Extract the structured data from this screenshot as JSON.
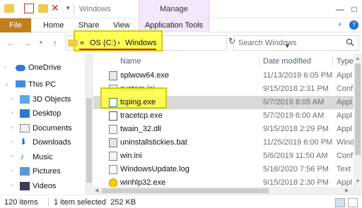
{
  "window": {
    "title": "Windows",
    "manage_label": "Manage",
    "minimize": "—",
    "maximize": "□"
  },
  "ribbon": {
    "tabs": [
      "File",
      "Home",
      "Share",
      "View"
    ],
    "app_tools": "Application Tools"
  },
  "navbar": {
    "breadcrumb": [
      {
        "label": "«"
      },
      {
        "label": "OS (C:)"
      },
      {
        "label": "›"
      },
      {
        "label": "Windows"
      }
    ],
    "search_placeholder": "Search Windows"
  },
  "sidebar": {
    "items": [
      {
        "label": "OneDrive",
        "icon": "cloud-icon"
      },
      {
        "label": "This PC",
        "icon": "computer-icon"
      },
      {
        "label": "3D Objects",
        "icon": "cube-icon"
      },
      {
        "label": "Desktop",
        "icon": "desktop-icon"
      },
      {
        "label": "Documents",
        "icon": "documents-icon"
      },
      {
        "label": "Downloads",
        "icon": "download-icon"
      },
      {
        "label": "Music",
        "icon": "music-icon"
      },
      {
        "label": "Pictures",
        "icon": "pictures-icon"
      },
      {
        "label": "Videos",
        "icon": "videos-icon"
      }
    ]
  },
  "list": {
    "columns": {
      "name": "Name",
      "date": "Date modified",
      "type": "Type"
    },
    "rows": [
      {
        "name": "splwow64.exe",
        "date": "11/13/2019 6:05 PM",
        "type": "Appl",
        "icon": "printer-icon"
      },
      {
        "name": "system.ini",
        "date": "9/15/2018 2:31 PM",
        "type": "Conf",
        "icon": "settings-file-icon"
      },
      {
        "name": "tcping.exe",
        "date": "5/7/2019 8:05 AM",
        "type": "Appl",
        "icon": "exe-icon"
      },
      {
        "name": "tracetcp.exe",
        "date": "5/7/2019 8:00 AM",
        "type": "Appl",
        "icon": "exe-icon"
      },
      {
        "name": "twain_32.dll",
        "date": "9/15/2018 2:29 PM",
        "type": "Appl",
        "icon": "dll-icon"
      },
      {
        "name": "uninstallstickies.bat",
        "date": "11/25/2019 6:00 PM",
        "type": "Wind",
        "icon": "batch-icon"
      },
      {
        "name": "win.ini",
        "date": "5/6/2019 11:50 AM",
        "type": "Conf",
        "icon": "settings-file-icon"
      },
      {
        "name": "WindowsUpdate.log",
        "date": "5/18/2020 7:56 PM",
        "type": "Text",
        "icon": "text-file-icon"
      },
      {
        "name": "winhlp32.exe",
        "date": "9/15/2018 2:30 PM",
        "type": "Appl",
        "icon": "help-icon"
      }
    ]
  },
  "status": {
    "items_count": "120 items",
    "selection": "1 item selected  252 KB"
  },
  "colors": {
    "file_tab": "#c47d1c",
    "highlight": "#ffff55",
    "underline": "#d61f1f",
    "manage_tab": "#f3e8fb"
  }
}
